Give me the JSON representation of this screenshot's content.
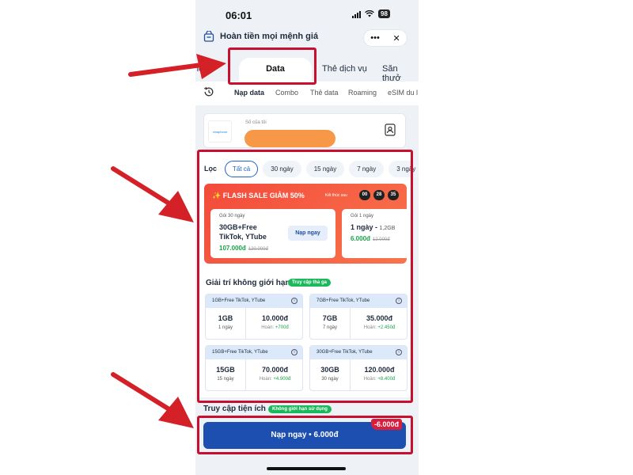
{
  "status_bar": {
    "time": "06:01",
    "battery": "98"
  },
  "header": {
    "title": "Hoàn tiền mọi mệnh giá",
    "more_icon": "•••",
    "close_icon": "✕"
  },
  "main_tabs": {
    "left_partial": "hoại",
    "active": "Data",
    "service": "Thẻ dịch vụ",
    "right_partial": "Săn thưở"
  },
  "sub_tabs": [
    "Nạp data",
    "Combo",
    "Thẻ data",
    "Roaming",
    "eSIM du l"
  ],
  "phone_card": {
    "carrier": "vinaphone",
    "label": "Số của tôi"
  },
  "filters": {
    "label": "Lọc",
    "chips": [
      "Tất cả",
      "30 ngày",
      "15 ngày",
      "7 ngày",
      "3 ngày"
    ],
    "active_chip": "Tất cả"
  },
  "flash_sale": {
    "title": "FLASH SALE GIẢM 50%",
    "ends_label": "Kết thúc sau",
    "timer": [
      "00",
      "28",
      "35"
    ],
    "offers": [
      {
        "label": "Gói 30 ngày",
        "name_line1": "30GB+Free",
        "name_line2": "TikTok, YTube",
        "price": "107.000đ",
        "old_price": "120.000đ",
        "button": "Nạp ngay"
      },
      {
        "label": "Gói 1 ngày",
        "name": "1 ngày -",
        "name_sub": "1,2GB",
        "price": "6.000đ",
        "old_price": "12.000đ"
      }
    ]
  },
  "unlimited_section": {
    "title": "Giải trí không giới hạn",
    "badge": "Truy cập thả ga"
  },
  "packages": [
    {
      "head": "1GB+Free TikTok, YTube",
      "volume": "1GB",
      "days": "1 ngày",
      "price": "10.000đ",
      "refund_label": "Hoàn:",
      "refund": "+700đ"
    },
    {
      "head": "7GB+Free TikTok, YTube",
      "volume": "7GB",
      "days": "7 ngày",
      "price": "35.000đ",
      "refund_label": "Hoàn:",
      "refund": "+2.450đ"
    },
    {
      "head": "15GB+Free TikTok, YTube",
      "volume": "15GB",
      "days": "15 ngày",
      "price": "70.000đ",
      "refund_label": "Hoàn:",
      "refund": "+4.900đ"
    },
    {
      "head": "30GB+Free TikTok, YTube",
      "volume": "30GB",
      "days": "30 ngày",
      "price": "120.000đ",
      "refund_label": "Hoàn:",
      "refund": "+8.400đ"
    }
  ],
  "utility_section": {
    "title": "Truy cập tiện ích",
    "badge": "Không giới hạn sử dụng"
  },
  "bottom": {
    "button": "Nạp ngay • 6.000đ",
    "discount": "-6.000đ"
  },
  "colors": {
    "primary": "#1d4fb1",
    "flash": "#f34a3a",
    "highlight": "#c8102e",
    "green": "#1cb85c"
  }
}
